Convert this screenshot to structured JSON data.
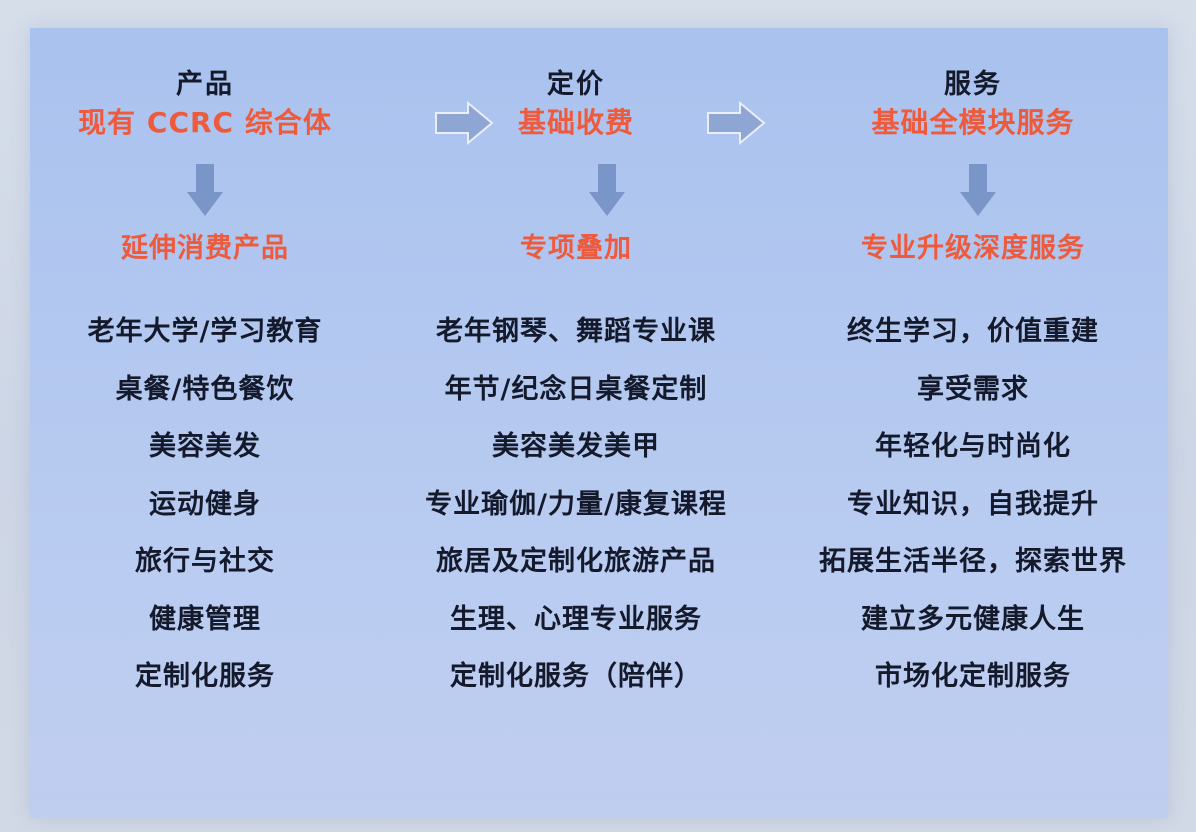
{
  "columns": [
    {
      "heading": "产品",
      "subheading": "现有 CCRC 综合体",
      "extension": "延伸消费产品",
      "items": [
        "老年大学/学习教育",
        "桌餐/特色餐饮",
        "美容美发",
        "运动健身",
        "旅行与社交",
        "健康管理",
        "定制化服务"
      ]
    },
    {
      "heading": "定价",
      "subheading": "基础收费",
      "extension": "专项叠加",
      "items": [
        "老年钢琴、舞蹈专业课",
        "年节/纪念日桌餐定制",
        "美容美发美甲",
        "专业瑜伽/力量/康复课程",
        "旅居及定制化旅游产品",
        "生理、心理专业服务",
        "定制化服务（陪伴）"
      ]
    },
    {
      "heading": "服务",
      "subheading": "基础全模块服务",
      "extension": "专业升级深度服务",
      "items": [
        "终生学习，价值重建",
        "享受需求",
        "年轻化与时尚化",
        "专业知识，自我提升",
        "拓展生活半径，探索世界",
        "建立多元健康人生",
        "市场化定制服务"
      ]
    }
  ],
  "colors": {
    "accent": "#ee5a3c",
    "text": "#141a2c",
    "arrow": "#7a95c8",
    "background": "#b3c8f0"
  },
  "icons": {
    "flow_right": "right-arrow-icon",
    "flow_down": "down-arrow-icon"
  }
}
